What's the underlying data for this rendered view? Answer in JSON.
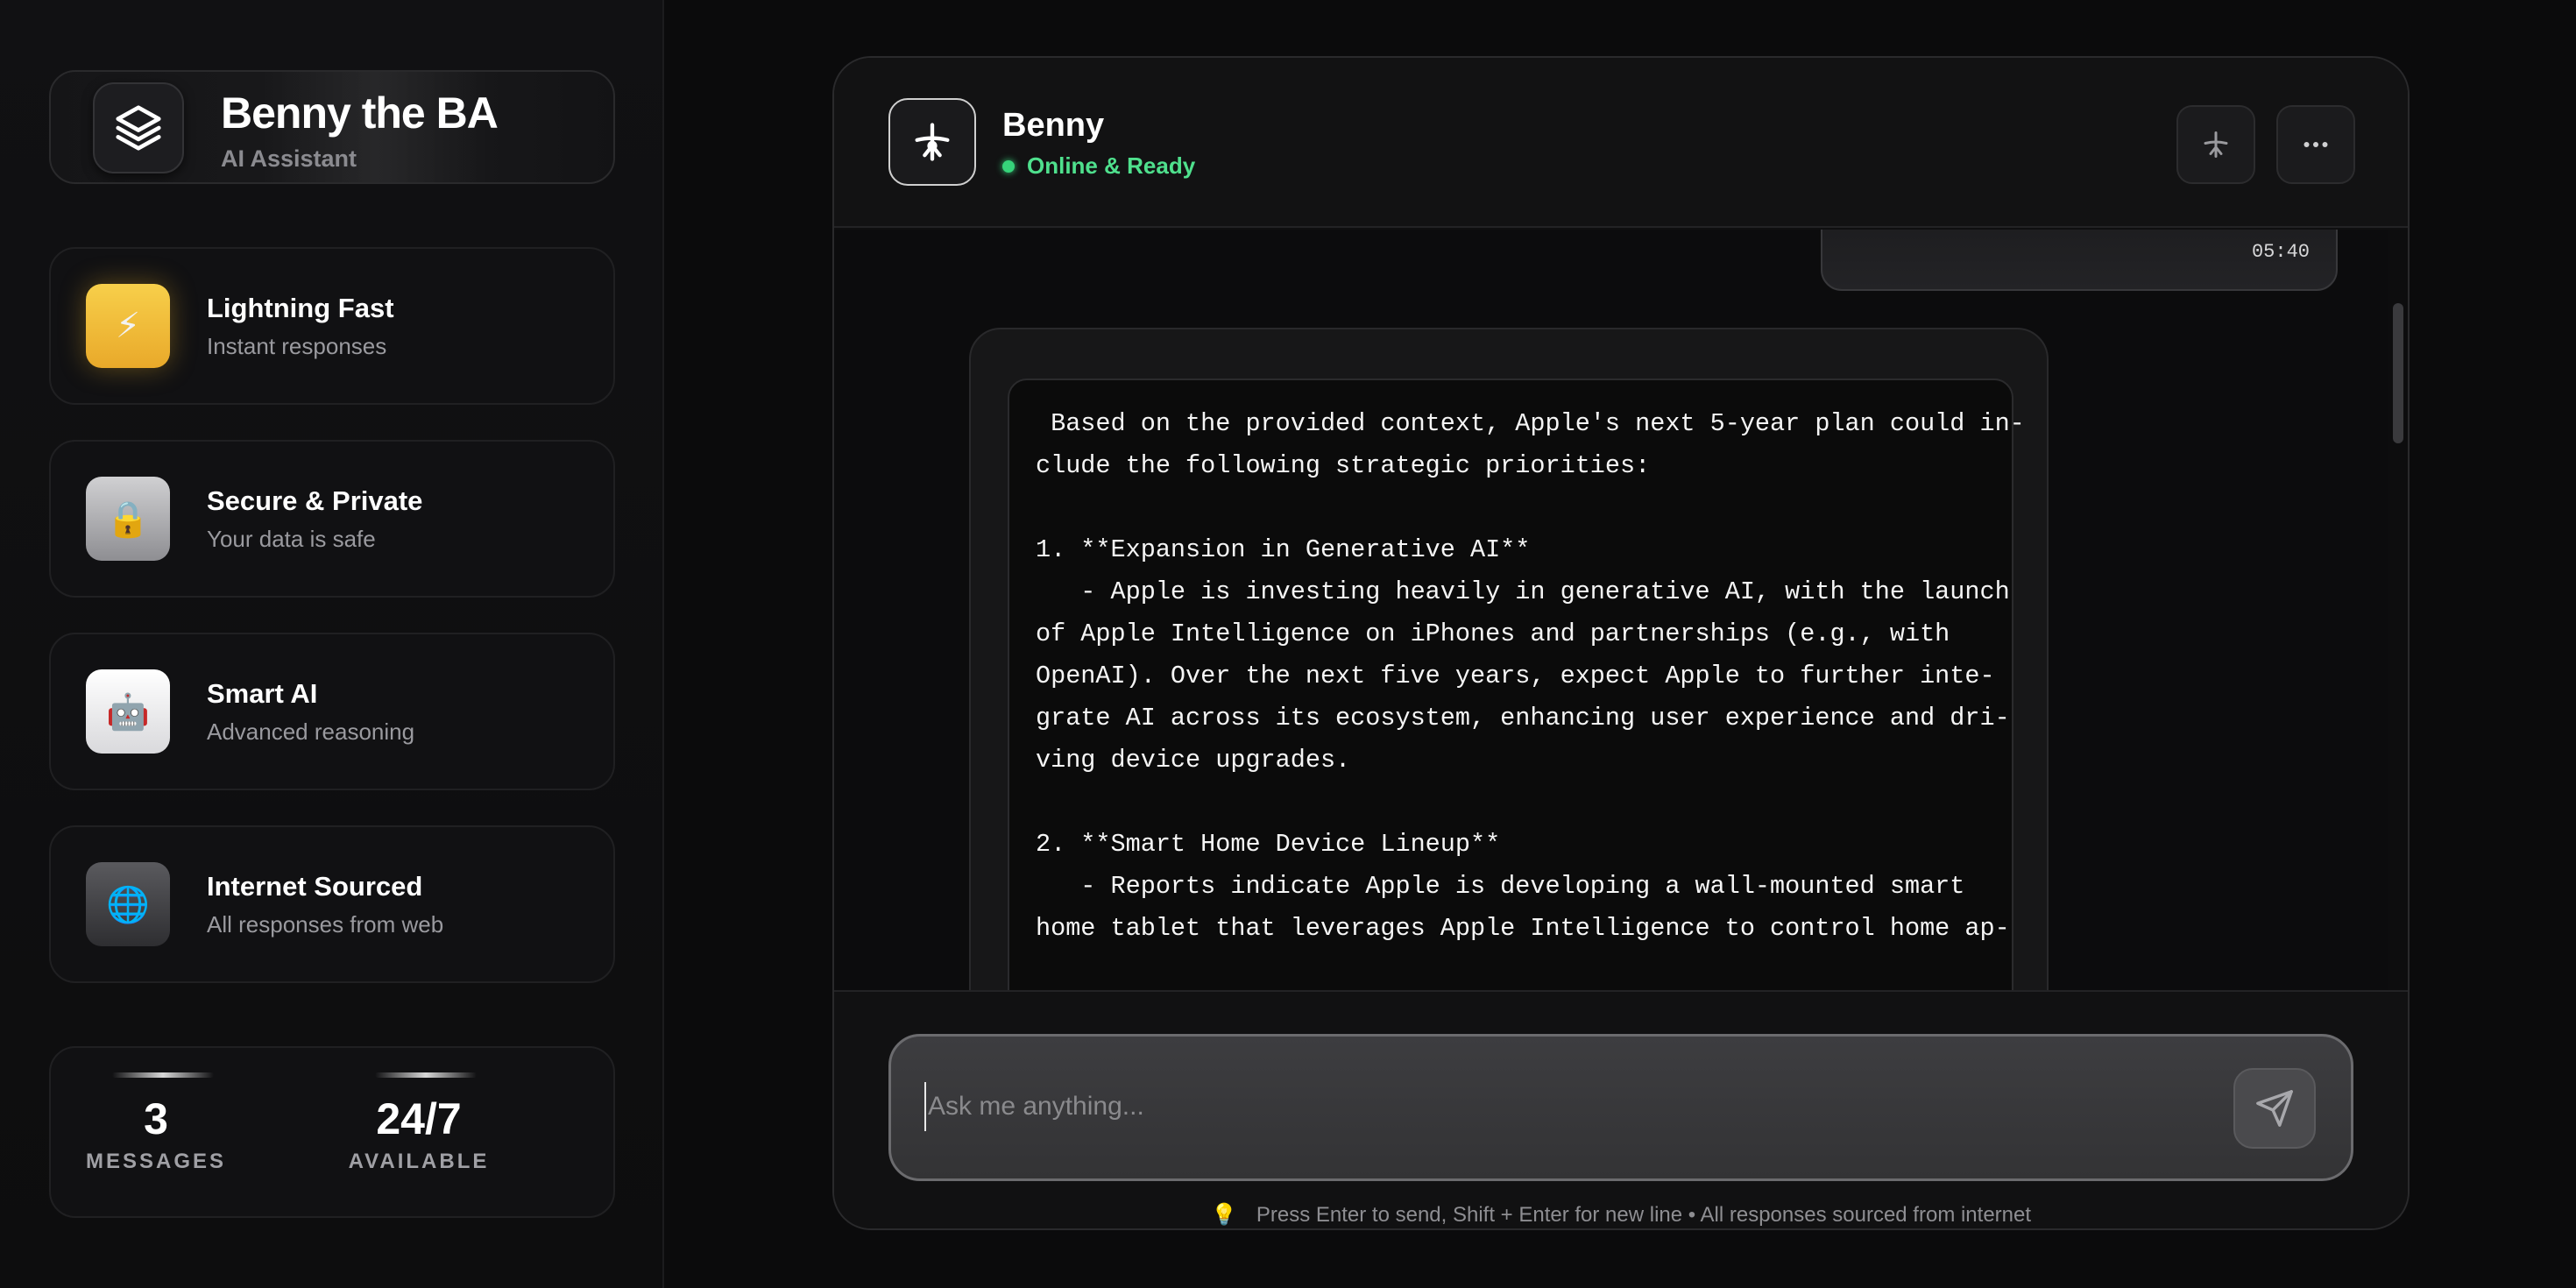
{
  "sidebar": {
    "brand": {
      "title": "Benny the BA",
      "subtitle": "AI Assistant",
      "icon": "layers-icon"
    },
    "features": [
      {
        "title": "Lightning Fast",
        "description": "Instant responses",
        "icon": "lightning-icon",
        "glyph": "⚡"
      },
      {
        "title": "Secure & Private",
        "description": "Your data is safe",
        "icon": "lock-icon",
        "glyph": "🔒"
      },
      {
        "title": "Smart AI",
        "description": "Advanced reasoning",
        "icon": "robot-icon",
        "glyph": "🤖"
      },
      {
        "title": "Internet Sourced",
        "description": "All responses from web",
        "icon": "globe-icon",
        "glyph": "🌐"
      }
    ],
    "stats": [
      {
        "value": "3",
        "label": "MESSAGES"
      },
      {
        "value": "24/7",
        "label": "AVAILABLE"
      }
    ]
  },
  "chat": {
    "header": {
      "name": "Benny",
      "status": "Online & Ready",
      "status_color": "#36d37a"
    },
    "previous_message": {
      "time": "05:40"
    },
    "ai_message": {
      "lines": [
        " Based on the provided context, Apple's next 5-year plan could in-",
        "clude the following strategic priorities:",
        "",
        "1. **Expansion in Generative AI**",
        "   - Apple is investing heavily in generative AI, with the launch",
        "of Apple Intelligence on iPhones and partnerships (e.g., with",
        "OpenAI). Over the next five years, expect Apple to further inte-",
        "grate AI across its ecosystem, enhancing user experience and dri-",
        "ving device upgrades.",
        "",
        "2. **Smart Home Device Lineup**",
        "   - Reports indicate Apple is developing a wall-mounted smart",
        "home tablet that leverages Apple Intelligence to control home ap-"
      ]
    },
    "composer": {
      "placeholder": "Ask me anything...",
      "value": "",
      "hint": "Press Enter to send, Shift + Enter for new line • All responses sourced from internet",
      "hint_icon": "lightbulb-icon"
    }
  }
}
